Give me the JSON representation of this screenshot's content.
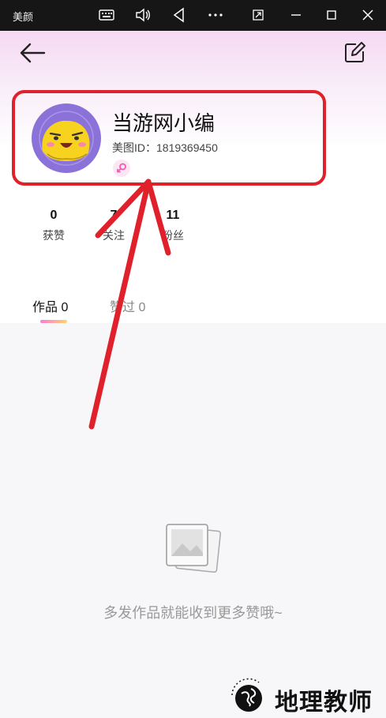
{
  "window": {
    "app_title": "美颜",
    "icons": [
      "keyboard-icon",
      "volume-icon",
      "back-triangle-icon",
      "more-icon",
      "restore-window-icon",
      "minimize-icon",
      "maximize-icon",
      "close-icon"
    ]
  },
  "profile": {
    "nickname": "当游网小编",
    "meitu_id": "美图ID：1819369450",
    "gender": "female"
  },
  "stats": [
    {
      "value": "0",
      "label": "获赞"
    },
    {
      "value": "7",
      "label": "关注"
    },
    {
      "value": "11",
      "label": "粉丝"
    }
  ],
  "tabs": [
    {
      "label": "作品 0",
      "active": true
    },
    {
      "label": "赞过 0",
      "active": false
    }
  ],
  "empty_state": {
    "message": "多发作品就能收到更多赞哦~"
  },
  "watermark": {
    "text": "地理教师"
  },
  "colors": {
    "highlight_red": "#e0202a",
    "tab_gradient_start": "#ff7ad6",
    "tab_gradient_end": "#ffd36b"
  }
}
